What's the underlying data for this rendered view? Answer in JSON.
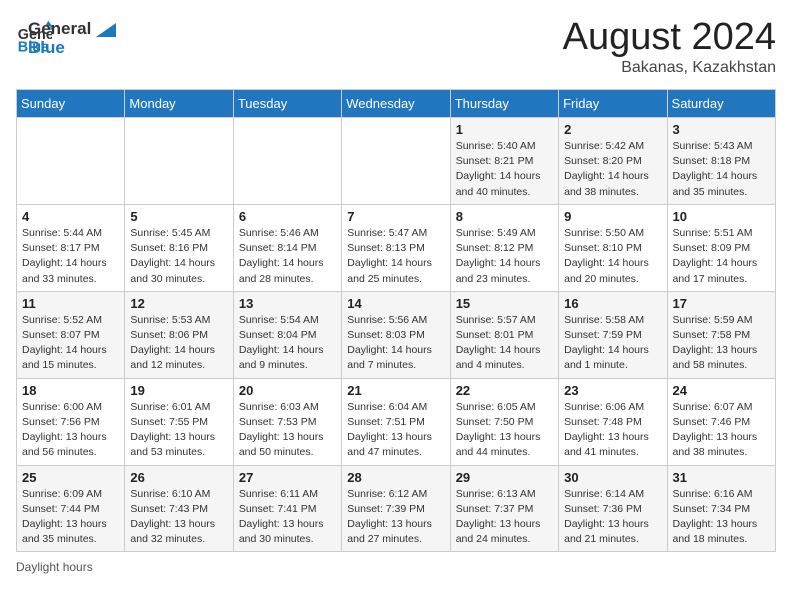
{
  "header": {
    "logo_text_general": "General",
    "logo_text_blue": "Blue",
    "month_year": "August 2024",
    "location": "Bakanas, Kazakhstan"
  },
  "days_of_week": [
    "Sunday",
    "Monday",
    "Tuesday",
    "Wednesday",
    "Thursday",
    "Friday",
    "Saturday"
  ],
  "weeks": [
    [
      {
        "day": "",
        "sunrise": "",
        "sunset": "",
        "daylight": ""
      },
      {
        "day": "",
        "sunrise": "",
        "sunset": "",
        "daylight": ""
      },
      {
        "day": "",
        "sunrise": "",
        "sunset": "",
        "daylight": ""
      },
      {
        "day": "",
        "sunrise": "",
        "sunset": "",
        "daylight": ""
      },
      {
        "day": "1",
        "sunrise": "Sunrise: 5:40 AM",
        "sunset": "Sunset: 8:21 PM",
        "daylight": "Daylight: 14 hours and 40 minutes."
      },
      {
        "day": "2",
        "sunrise": "Sunrise: 5:42 AM",
        "sunset": "Sunset: 8:20 PM",
        "daylight": "Daylight: 14 hours and 38 minutes."
      },
      {
        "day": "3",
        "sunrise": "Sunrise: 5:43 AM",
        "sunset": "Sunset: 8:18 PM",
        "daylight": "Daylight: 14 hours and 35 minutes."
      }
    ],
    [
      {
        "day": "4",
        "sunrise": "Sunrise: 5:44 AM",
        "sunset": "Sunset: 8:17 PM",
        "daylight": "Daylight: 14 hours and 33 minutes."
      },
      {
        "day": "5",
        "sunrise": "Sunrise: 5:45 AM",
        "sunset": "Sunset: 8:16 PM",
        "daylight": "Daylight: 14 hours and 30 minutes."
      },
      {
        "day": "6",
        "sunrise": "Sunrise: 5:46 AM",
        "sunset": "Sunset: 8:14 PM",
        "daylight": "Daylight: 14 hours and 28 minutes."
      },
      {
        "day": "7",
        "sunrise": "Sunrise: 5:47 AM",
        "sunset": "Sunset: 8:13 PM",
        "daylight": "Daylight: 14 hours and 25 minutes."
      },
      {
        "day": "8",
        "sunrise": "Sunrise: 5:49 AM",
        "sunset": "Sunset: 8:12 PM",
        "daylight": "Daylight: 14 hours and 23 minutes."
      },
      {
        "day": "9",
        "sunrise": "Sunrise: 5:50 AM",
        "sunset": "Sunset: 8:10 PM",
        "daylight": "Daylight: 14 hours and 20 minutes."
      },
      {
        "day": "10",
        "sunrise": "Sunrise: 5:51 AM",
        "sunset": "Sunset: 8:09 PM",
        "daylight": "Daylight: 14 hours and 17 minutes."
      }
    ],
    [
      {
        "day": "11",
        "sunrise": "Sunrise: 5:52 AM",
        "sunset": "Sunset: 8:07 PM",
        "daylight": "Daylight: 14 hours and 15 minutes."
      },
      {
        "day": "12",
        "sunrise": "Sunrise: 5:53 AM",
        "sunset": "Sunset: 8:06 PM",
        "daylight": "Daylight: 14 hours and 12 minutes."
      },
      {
        "day": "13",
        "sunrise": "Sunrise: 5:54 AM",
        "sunset": "Sunset: 8:04 PM",
        "daylight": "Daylight: 14 hours and 9 minutes."
      },
      {
        "day": "14",
        "sunrise": "Sunrise: 5:56 AM",
        "sunset": "Sunset: 8:03 PM",
        "daylight": "Daylight: 14 hours and 7 minutes."
      },
      {
        "day": "15",
        "sunrise": "Sunrise: 5:57 AM",
        "sunset": "Sunset: 8:01 PM",
        "daylight": "Daylight: 14 hours and 4 minutes."
      },
      {
        "day": "16",
        "sunrise": "Sunrise: 5:58 AM",
        "sunset": "Sunset: 7:59 PM",
        "daylight": "Daylight: 14 hours and 1 minute."
      },
      {
        "day": "17",
        "sunrise": "Sunrise: 5:59 AM",
        "sunset": "Sunset: 7:58 PM",
        "daylight": "Daylight: 13 hours and 58 minutes."
      }
    ],
    [
      {
        "day": "18",
        "sunrise": "Sunrise: 6:00 AM",
        "sunset": "Sunset: 7:56 PM",
        "daylight": "Daylight: 13 hours and 56 minutes."
      },
      {
        "day": "19",
        "sunrise": "Sunrise: 6:01 AM",
        "sunset": "Sunset: 7:55 PM",
        "daylight": "Daylight: 13 hours and 53 minutes."
      },
      {
        "day": "20",
        "sunrise": "Sunrise: 6:03 AM",
        "sunset": "Sunset: 7:53 PM",
        "daylight": "Daylight: 13 hours and 50 minutes."
      },
      {
        "day": "21",
        "sunrise": "Sunrise: 6:04 AM",
        "sunset": "Sunset: 7:51 PM",
        "daylight": "Daylight: 13 hours and 47 minutes."
      },
      {
        "day": "22",
        "sunrise": "Sunrise: 6:05 AM",
        "sunset": "Sunset: 7:50 PM",
        "daylight": "Daylight: 13 hours and 44 minutes."
      },
      {
        "day": "23",
        "sunrise": "Sunrise: 6:06 AM",
        "sunset": "Sunset: 7:48 PM",
        "daylight": "Daylight: 13 hours and 41 minutes."
      },
      {
        "day": "24",
        "sunrise": "Sunrise: 6:07 AM",
        "sunset": "Sunset: 7:46 PM",
        "daylight": "Daylight: 13 hours and 38 minutes."
      }
    ],
    [
      {
        "day": "25",
        "sunrise": "Sunrise: 6:09 AM",
        "sunset": "Sunset: 7:44 PM",
        "daylight": "Daylight: 13 hours and 35 minutes."
      },
      {
        "day": "26",
        "sunrise": "Sunrise: 6:10 AM",
        "sunset": "Sunset: 7:43 PM",
        "daylight": "Daylight: 13 hours and 32 minutes."
      },
      {
        "day": "27",
        "sunrise": "Sunrise: 6:11 AM",
        "sunset": "Sunset: 7:41 PM",
        "daylight": "Daylight: 13 hours and 30 minutes."
      },
      {
        "day": "28",
        "sunrise": "Sunrise: 6:12 AM",
        "sunset": "Sunset: 7:39 PM",
        "daylight": "Daylight: 13 hours and 27 minutes."
      },
      {
        "day": "29",
        "sunrise": "Sunrise: 6:13 AM",
        "sunset": "Sunset: 7:37 PM",
        "daylight": "Daylight: 13 hours and 24 minutes."
      },
      {
        "day": "30",
        "sunrise": "Sunrise: 6:14 AM",
        "sunset": "Sunset: 7:36 PM",
        "daylight": "Daylight: 13 hours and 21 minutes."
      },
      {
        "day": "31",
        "sunrise": "Sunrise: 6:16 AM",
        "sunset": "Sunset: 7:34 PM",
        "daylight": "Daylight: 13 hours and 18 minutes."
      }
    ]
  ],
  "footer": {
    "daylight_label": "Daylight hours"
  }
}
